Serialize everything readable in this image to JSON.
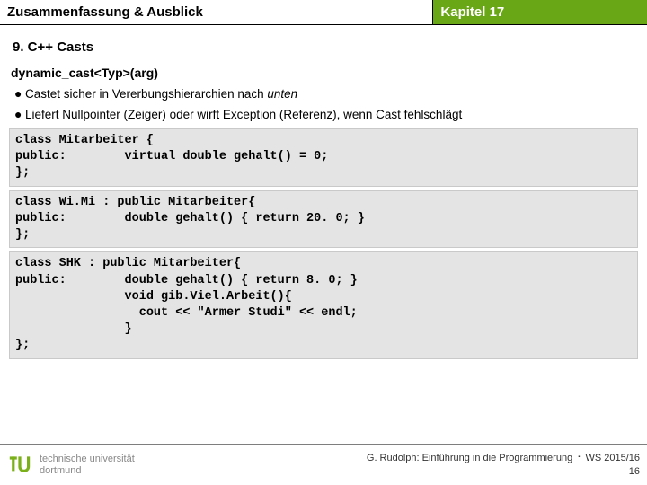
{
  "header": {
    "left": "Zusammenfassung & Ausblick",
    "right": "Kapitel 17"
  },
  "section_title": "9. C++ Casts",
  "cast_signature": "dynamic_cast<Typ>(arg)",
  "bullets": [
    {
      "pre": "Castet sicher in Vererbungshierarchien nach ",
      "em": "unten",
      "post": ""
    },
    {
      "pre": "Liefert Nullpointer (Zeiger) oder wirft Exception (Referenz), wenn Cast fehlschlägt",
      "em": "",
      "post": ""
    }
  ],
  "code": [
    "class Mitarbeiter {\npublic:        virtual double gehalt() = 0;\n};",
    "class Wi.Mi : public Mitarbeiter{\npublic:        double gehalt() { return 20. 0; }\n};",
    "class SHK : public Mitarbeiter{\npublic:        double gehalt() { return 8. 0; }\n               void gib.Viel.Arbeit(){\n                 cout << \"Armer Studi\" << endl;\n               }\n};"
  ],
  "footer": {
    "uni_line1": "technische universität",
    "uni_line2": "dortmund",
    "right_line1a": "G. Rudolph: Einführung in die Programmierung",
    "right_line1b": "WS 2015/16",
    "page": "16"
  }
}
